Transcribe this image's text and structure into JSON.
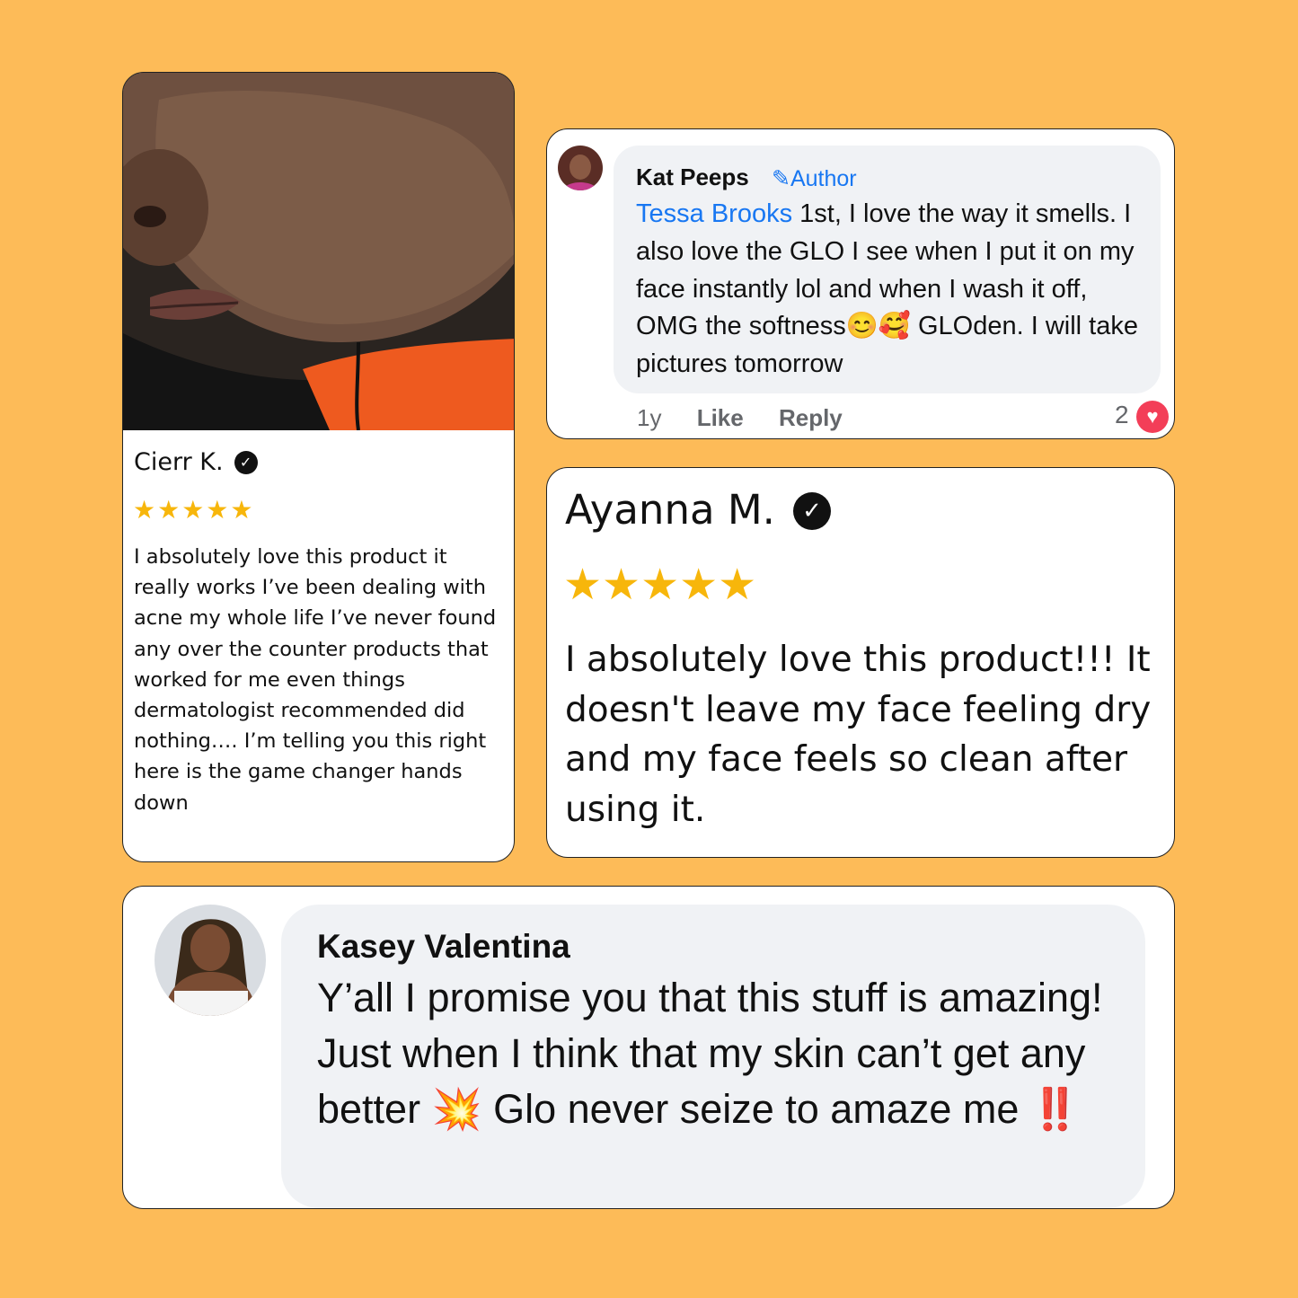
{
  "reviews": {
    "cierr": {
      "name": "Cierr K.",
      "verified_icon": "check-badge-icon",
      "stars": "★★★★★",
      "rating": 5,
      "text": "I absolutely love this product it really works I’ve been dealing with acne my whole life I’ve never found any over the counter products that worked for me even things dermatologist recommended did nothing…. I’m telling you this right here is the game changer hands down"
    },
    "kat": {
      "name": "Kat Peeps",
      "badge": "Author",
      "badge_icon": "pencil-icon",
      "tag": "Tessa Brooks",
      "text": " 1st, I love the way it smells. I also love the GLO I see when I put it on my face instantly lol and when I wash it off, OMG the softness😊🥰 GLOden. I will take pictures tomorrow",
      "time": "1y",
      "like": "Like",
      "reply": "Reply",
      "reaction_count": "2",
      "reaction_icon": "heart-icon"
    },
    "ayanna": {
      "name": "Ayanna M.",
      "verified_icon": "check-badge-icon",
      "stars": "★★★★★",
      "rating": 5,
      "text": "I absolutely love this product!!! It doesn't leave my face feeling dry and  my face feels so clean after using it."
    },
    "kasey": {
      "name": "Kasey Valentina",
      "text": "Y’all I promise you that this stuff is amazing! Just when I think that my skin can’t get any better ",
      "emoji1": "💥",
      "text2": " Glo never seize to amaze me ",
      "emoji2": "‼️"
    }
  },
  "colors": {
    "background": "#FDBB58",
    "star": "#F7B60B",
    "link": "#1877F2",
    "bubble": "#F0F2F5",
    "heart": "#F33E58"
  }
}
